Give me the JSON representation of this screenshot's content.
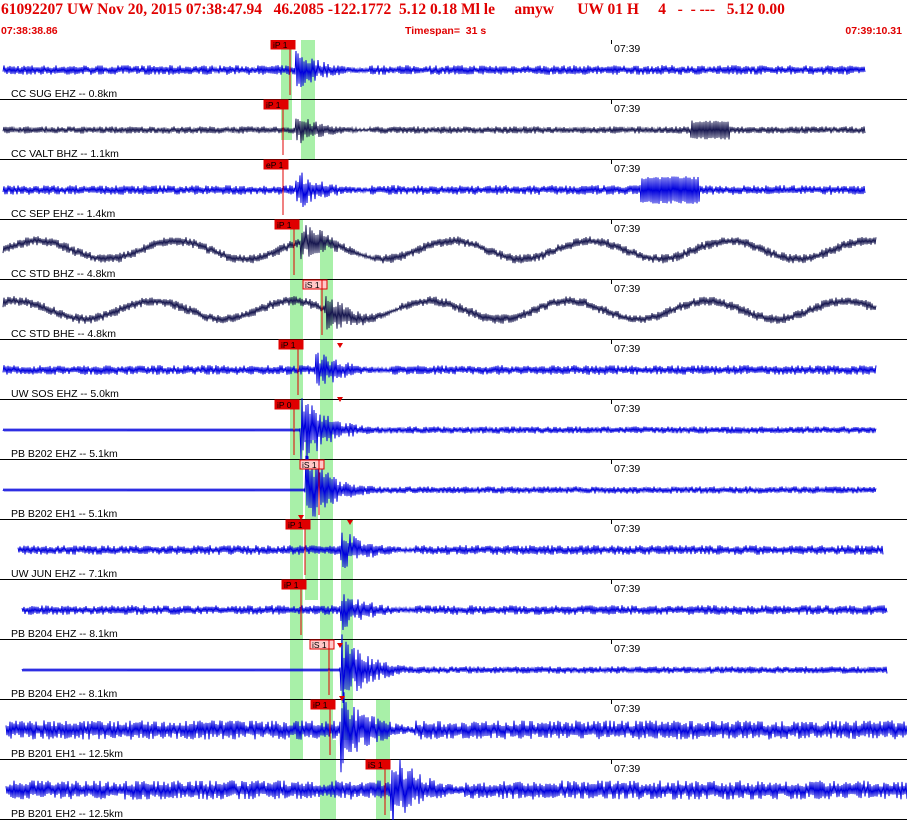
{
  "header": {
    "title": "61092207 UW Nov 20, 2015 07:38:47.94   46.2085 -122.1772  5.12 0.18 Ml le     amyw      UW 01 H     4   -  - ---   5.12 0.00",
    "start_time": "07:38:38.86",
    "timespan": "Timespan=  31 s",
    "end_time": "07:39:10.31"
  },
  "tick_label": "07:39",
  "colors": {
    "header_red": "#e00000",
    "trace_blue": "#0000dd",
    "trace_navy": "#181850",
    "pick_red": "#e00000",
    "pick_pink": "#ffc8c8",
    "window_green": "#a8f0a8"
  },
  "traces": [
    {
      "label": "CC SUG EHZ -- 0.8km",
      "pick": "iP 1",
      "color": "blue"
    },
    {
      "label": "CC VALT BHZ -- 1.1km",
      "pick": "iP 1",
      "color": "navy"
    },
    {
      "label": "CC SEP EHZ -- 1.4km",
      "pick": "eP 1",
      "color": "blue"
    },
    {
      "label": "CC STD BHZ -- 4.8km",
      "pick": "iP 1",
      "color": "navy"
    },
    {
      "label": "CC STD BHE -- 4.8km",
      "pick": "iS 1",
      "color": "navy"
    },
    {
      "label": "UW SOS EHZ -- 5.0km",
      "pick": "iP 1",
      "color": "blue"
    },
    {
      "label": "PB B202 EHZ -- 5.1km",
      "pick": "iP 0",
      "color": "blue"
    },
    {
      "label": "PB B202 EH1 -- 5.1km",
      "pick": "iS 1",
      "color": "blue"
    },
    {
      "label": "UW JUN EHZ -- 7.1km",
      "pick": "iP 1",
      "color": "blue"
    },
    {
      "label": "PB B204 EHZ -- 8.1km",
      "pick": "iP 1",
      "color": "blue"
    },
    {
      "label": "PB B204 EH2 -- 8.1km",
      "pick": "iS 1",
      "color": "blue"
    },
    {
      "label": "PB B201 EH1 -- 12.5km",
      "pick": "iP 1",
      "color": "blue"
    },
    {
      "label": "PB B201 EH2 -- 12.5km",
      "pick": "iS 1",
      "color": "blue"
    }
  ]
}
